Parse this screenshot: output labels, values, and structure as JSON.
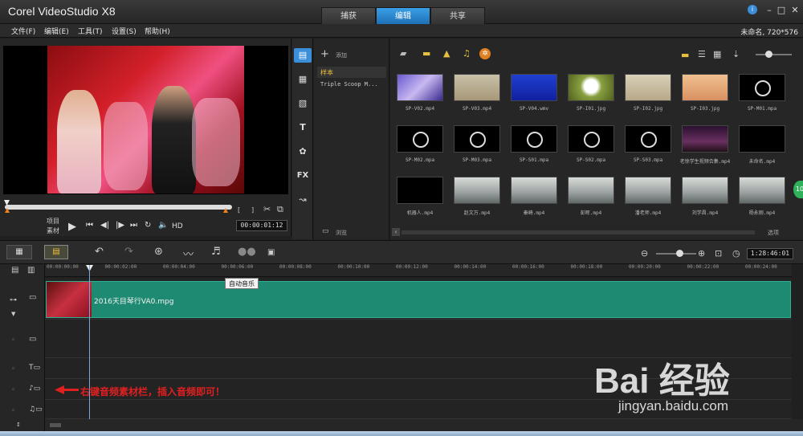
{
  "app": {
    "title": "Corel  VideoStudio X8"
  },
  "step_tabs": [
    {
      "label": "捕获"
    },
    {
      "label": "编辑"
    },
    {
      "label": "共享"
    }
  ],
  "window_buttons": {
    "minimize": "–",
    "maximize": "□",
    "close": "✕",
    "globe": "i"
  },
  "menu": {
    "items": [
      {
        "label": "文件(F)"
      },
      {
        "label": "编辑(E)"
      },
      {
        "label": "工具(T)"
      },
      {
        "label": "设置(S)"
      },
      {
        "label": "帮助(H)"
      }
    ],
    "project_info": "未命名, 720*576"
  },
  "player": {
    "mode_project": "项目",
    "mode_clip": "素材",
    "hd_label": "HD",
    "timecode": "00:00:01:12",
    "bracket_in": "[",
    "bracket_out": "]"
  },
  "library": {
    "add_label": "添加",
    "folders": [
      {
        "label": "样本"
      },
      {
        "label": "Triple Scoop M..."
      }
    ],
    "browse_label": "浏览",
    "options_label": "选项",
    "items": [
      {
        "label": "SP-V02.mp4",
        "kind": "video-blue"
      },
      {
        "label": "SP-V03.mp4",
        "kind": "beige"
      },
      {
        "label": "SP-V04.wmv",
        "kind": "blue"
      },
      {
        "label": "SP-I01.jpg",
        "kind": "dandelion"
      },
      {
        "label": "SP-I02.jpg",
        "kind": "sand"
      },
      {
        "label": "SP-I03.jpg",
        "kind": "tree"
      },
      {
        "label": "SP-M01.mpa",
        "kind": "disc"
      },
      {
        "label": "SP-M02.mpa",
        "kind": "disc"
      },
      {
        "label": "SP-M03.mpa",
        "kind": "disc"
      },
      {
        "label": "SP-S01.mpa",
        "kind": "disc"
      },
      {
        "label": "SP-S02.mpa",
        "kind": "disc"
      },
      {
        "label": "SP-S03.mpa",
        "kind": "disc"
      },
      {
        "label": "老徐学生视频合集.mp4",
        "kind": "dark-purple"
      },
      {
        "label": "未命名.mp4",
        "kind": "black"
      },
      {
        "label": "机器人.mp4",
        "kind": "black"
      },
      {
        "label": "赵文万.mp4",
        "kind": "class"
      },
      {
        "label": "秦崎.mp4",
        "kind": "class"
      },
      {
        "label": "彭晖.mp4",
        "kind": "class"
      },
      {
        "label": "潘老师.mp4",
        "kind": "class"
      },
      {
        "label": "刘学昌.mp4",
        "kind": "class"
      },
      {
        "label": "杨永刚.mp4",
        "kind": "class"
      }
    ]
  },
  "timeline": {
    "ruler_ticks": [
      "00:00:00:00",
      "00:00:02:00",
      "00:00:04:00",
      "00:00:06:00",
      "00:00:08:00",
      "00:00:10:00",
      "00:00:12:00",
      "00:00:14:00",
      "00:00:16:00",
      "00:00:18:00",
      "00:00:20:00",
      "00:00:22:00",
      "00:00:24:00"
    ],
    "tooltip": "自动音乐",
    "duration": "1:28:46:01",
    "clip_label": "2016天目琴行VA0.mpg",
    "hint": "右键音频素材栏，插入音频即可！"
  },
  "watermark": {
    "text": "Bai 经验",
    "url": "jingyan.baidu.com"
  },
  "colors": {
    "accent_tab": "#2a86d0",
    "clip": "#1e8a72",
    "hint": "#e02020"
  }
}
